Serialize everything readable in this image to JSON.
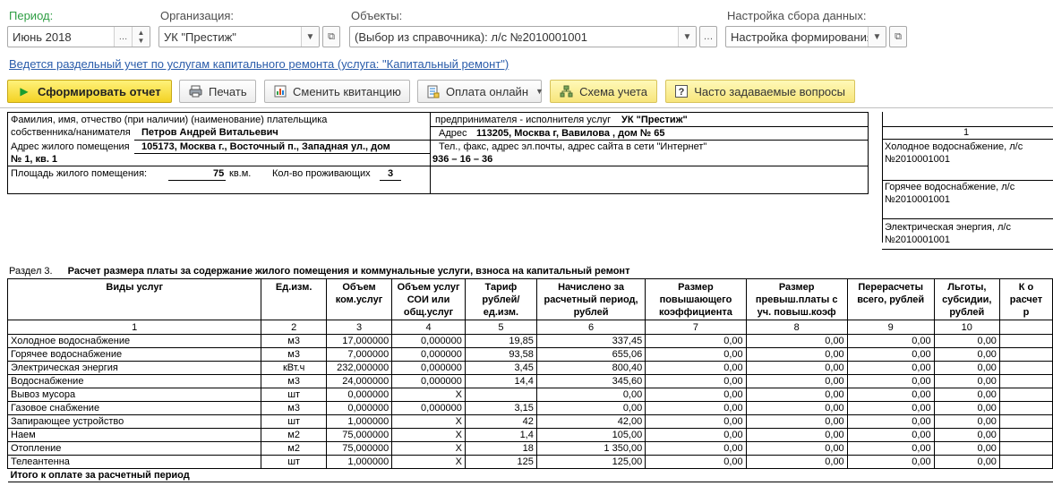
{
  "filters": {
    "period_label": "Период:",
    "period_value": "Июнь 2018",
    "org_label": "Организация:",
    "org_value": "УК \"Престиж\"",
    "objects_label": "Объекты:",
    "objects_value": "(Выбор из справочника): л/с №2010001001",
    "settings_label": "Настройка сбора данных:",
    "settings_value": "Настройка формирования"
  },
  "info_link": "Ведется раздельный учет по услугам капитального ремонта (услуга: \"Капитальный ремонт\")",
  "toolbar": {
    "generate": "Сформировать отчет",
    "print": "Печать",
    "change_receipt": "Сменить квитанцию",
    "pay_online": "Оплата онлайн",
    "accounting_scheme": "Схема учета",
    "faq": "Часто задаваемые вопросы"
  },
  "header": {
    "payer_caption_1": "Фамилия, имя, отчество (при наличии) (наименование) плательщика",
    "payer_caption_2": "собственника/нанимателя",
    "payer_name": "Петров Андрей Витальевич",
    "address_caption": "Адрес жилого помещения",
    "address_value_1": "105173, Москва г., Восточный п., Западная ул., дом",
    "address_value_2": "№ 1, кв. 1",
    "area_caption": "Площадь жилого помещения:",
    "area_value": "75",
    "area_unit": "кв.м.",
    "residents_caption": "Кол-во проживающих",
    "residents_value": "3",
    "provider_caption": "предпринимателя - исполнителя услуг",
    "provider_name": "УК \"Престиж\"",
    "provider_address_caption": "Адрес",
    "provider_address": "113205, Москва г, Вавилова , дом № 65",
    "contacts_caption": "Тел., факс, адрес эл.почты, адрес сайта в сети \"Интернет\"",
    "contacts_value": "936 – 16 – 36"
  },
  "right_panel": {
    "number": "1",
    "items": [
      {
        "line1": "Холодное водоснабжение, л/с",
        "line2": "№2010001001"
      },
      {
        "line1": "Горячее водоснабжение, л/с",
        "line2": "№2010001001"
      },
      {
        "line1": "Электрическая энергия, л/с",
        "line2": "№2010001001"
      }
    ]
  },
  "section": {
    "number": "Раздел 3.",
    "title": "Расчет размера платы за содержание жилого помещения и коммунальные услуги, взноса на капитальный ремонт"
  },
  "table": {
    "headers": [
      [
        "Виды услуг"
      ],
      [
        "Ед.изм."
      ],
      [
        "Объем",
        "ком.услуг"
      ],
      [
        "Объем услуг",
        "СОИ или",
        "общ.услуг"
      ],
      [
        "Тариф",
        "рублей/",
        "ед.изм."
      ],
      [
        "Начислено за",
        "расчетный период,",
        "рублей"
      ],
      [
        "Размер",
        "повышающего",
        "коэффициента"
      ],
      [
        "Размер",
        "превыш.платы с",
        "уч. повыш.коэф"
      ],
      [
        "Перерасчеты",
        "всего, рублей"
      ],
      [
        "Льготы,",
        "субсидии,",
        "рублей"
      ],
      [
        "К о",
        "расчет",
        "р"
      ]
    ],
    "column_numbers": [
      "1",
      "2",
      "3",
      "4",
      "5",
      "6",
      "7",
      "8",
      "9",
      "10",
      ""
    ],
    "rows": [
      [
        "Холодное водоснабжение",
        "м3",
        "17,000000",
        "0,000000",
        "19,85",
        "337,45",
        "0,00",
        "0,00",
        "0,00",
        "0,00",
        ""
      ],
      [
        "Горячее водоснабжение",
        "м3",
        "7,000000",
        "0,000000",
        "93,58",
        "655,06",
        "0,00",
        "0,00",
        "0,00",
        "0,00",
        ""
      ],
      [
        "Электрическая энергия",
        "кВт.ч",
        "232,000000",
        "0,000000",
        "3,45",
        "800,40",
        "0,00",
        "0,00",
        "0,00",
        "0,00",
        ""
      ],
      [
        "Водоснабжение",
        "м3",
        "24,000000",
        "0,000000",
        "14,4",
        "345,60",
        "0,00",
        "0,00",
        "0,00",
        "0,00",
        ""
      ],
      [
        "Вывоз мусора",
        "шт",
        "0,000000",
        "X",
        "",
        "0,00",
        "0,00",
        "0,00",
        "0,00",
        "0,00",
        ""
      ],
      [
        "Газовое снабжение",
        "м3",
        "0,000000",
        "0,000000",
        "3,15",
        "0,00",
        "0,00",
        "0,00",
        "0,00",
        "0,00",
        ""
      ],
      [
        "Запирающее устройство",
        "шт",
        "1,000000",
        "X",
        "42",
        "42,00",
        "0,00",
        "0,00",
        "0,00",
        "0,00",
        ""
      ],
      [
        "Наем",
        "м2",
        "75,000000",
        "X",
        "1,4",
        "105,00",
        "0,00",
        "0,00",
        "0,00",
        "0,00",
        ""
      ],
      [
        "Отопление",
        "м2",
        "75,000000",
        "X",
        "18",
        "1 350,00",
        "0,00",
        "0,00",
        "0,00",
        "0,00",
        ""
      ],
      [
        "Телеантенна",
        "шт",
        "1,000000",
        "X",
        "125",
        "125,00",
        "0,00",
        "0,00",
        "0,00",
        "0,00",
        ""
      ]
    ],
    "total_label": "Итого к оплате за расчетный период"
  }
}
